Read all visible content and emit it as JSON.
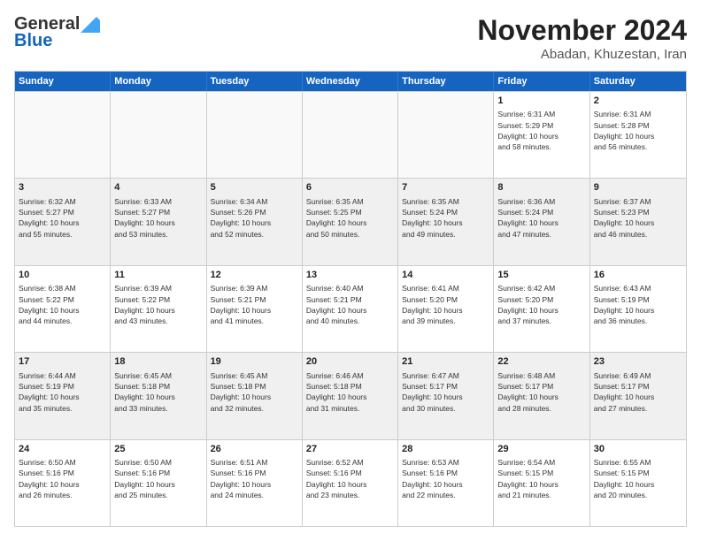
{
  "header": {
    "logo_general": "General",
    "logo_blue": "Blue",
    "month": "November 2024",
    "location": "Abadan, Khuzestan, Iran"
  },
  "days_of_week": [
    "Sunday",
    "Monday",
    "Tuesday",
    "Wednesday",
    "Thursday",
    "Friday",
    "Saturday"
  ],
  "rows": [
    [
      {
        "day": "",
        "info": "",
        "empty": true
      },
      {
        "day": "",
        "info": "",
        "empty": true
      },
      {
        "day": "",
        "info": "",
        "empty": true
      },
      {
        "day": "",
        "info": "",
        "empty": true
      },
      {
        "day": "",
        "info": "",
        "empty": true
      },
      {
        "day": "1",
        "info": "Sunrise: 6:31 AM\nSunset: 5:29 PM\nDaylight: 10 hours\nand 58 minutes."
      },
      {
        "day": "2",
        "info": "Sunrise: 6:31 AM\nSunset: 5:28 PM\nDaylight: 10 hours\nand 56 minutes."
      }
    ],
    [
      {
        "day": "3",
        "info": "Sunrise: 6:32 AM\nSunset: 5:27 PM\nDaylight: 10 hours\nand 55 minutes."
      },
      {
        "day": "4",
        "info": "Sunrise: 6:33 AM\nSunset: 5:27 PM\nDaylight: 10 hours\nand 53 minutes."
      },
      {
        "day": "5",
        "info": "Sunrise: 6:34 AM\nSunset: 5:26 PM\nDaylight: 10 hours\nand 52 minutes."
      },
      {
        "day": "6",
        "info": "Sunrise: 6:35 AM\nSunset: 5:25 PM\nDaylight: 10 hours\nand 50 minutes."
      },
      {
        "day": "7",
        "info": "Sunrise: 6:35 AM\nSunset: 5:24 PM\nDaylight: 10 hours\nand 49 minutes."
      },
      {
        "day": "8",
        "info": "Sunrise: 6:36 AM\nSunset: 5:24 PM\nDaylight: 10 hours\nand 47 minutes."
      },
      {
        "day": "9",
        "info": "Sunrise: 6:37 AM\nSunset: 5:23 PM\nDaylight: 10 hours\nand 46 minutes."
      }
    ],
    [
      {
        "day": "10",
        "info": "Sunrise: 6:38 AM\nSunset: 5:22 PM\nDaylight: 10 hours\nand 44 minutes."
      },
      {
        "day": "11",
        "info": "Sunrise: 6:39 AM\nSunset: 5:22 PM\nDaylight: 10 hours\nand 43 minutes."
      },
      {
        "day": "12",
        "info": "Sunrise: 6:39 AM\nSunset: 5:21 PM\nDaylight: 10 hours\nand 41 minutes."
      },
      {
        "day": "13",
        "info": "Sunrise: 6:40 AM\nSunset: 5:21 PM\nDaylight: 10 hours\nand 40 minutes."
      },
      {
        "day": "14",
        "info": "Sunrise: 6:41 AM\nSunset: 5:20 PM\nDaylight: 10 hours\nand 39 minutes."
      },
      {
        "day": "15",
        "info": "Sunrise: 6:42 AM\nSunset: 5:20 PM\nDaylight: 10 hours\nand 37 minutes."
      },
      {
        "day": "16",
        "info": "Sunrise: 6:43 AM\nSunset: 5:19 PM\nDaylight: 10 hours\nand 36 minutes."
      }
    ],
    [
      {
        "day": "17",
        "info": "Sunrise: 6:44 AM\nSunset: 5:19 PM\nDaylight: 10 hours\nand 35 minutes."
      },
      {
        "day": "18",
        "info": "Sunrise: 6:45 AM\nSunset: 5:18 PM\nDaylight: 10 hours\nand 33 minutes."
      },
      {
        "day": "19",
        "info": "Sunrise: 6:45 AM\nSunset: 5:18 PM\nDaylight: 10 hours\nand 32 minutes."
      },
      {
        "day": "20",
        "info": "Sunrise: 6:46 AM\nSunset: 5:18 PM\nDaylight: 10 hours\nand 31 minutes."
      },
      {
        "day": "21",
        "info": "Sunrise: 6:47 AM\nSunset: 5:17 PM\nDaylight: 10 hours\nand 30 minutes."
      },
      {
        "day": "22",
        "info": "Sunrise: 6:48 AM\nSunset: 5:17 PM\nDaylight: 10 hours\nand 28 minutes."
      },
      {
        "day": "23",
        "info": "Sunrise: 6:49 AM\nSunset: 5:17 PM\nDaylight: 10 hours\nand 27 minutes."
      }
    ],
    [
      {
        "day": "24",
        "info": "Sunrise: 6:50 AM\nSunset: 5:16 PM\nDaylight: 10 hours\nand 26 minutes."
      },
      {
        "day": "25",
        "info": "Sunrise: 6:50 AM\nSunset: 5:16 PM\nDaylight: 10 hours\nand 25 minutes."
      },
      {
        "day": "26",
        "info": "Sunrise: 6:51 AM\nSunset: 5:16 PM\nDaylight: 10 hours\nand 24 minutes."
      },
      {
        "day": "27",
        "info": "Sunrise: 6:52 AM\nSunset: 5:16 PM\nDaylight: 10 hours\nand 23 minutes."
      },
      {
        "day": "28",
        "info": "Sunrise: 6:53 AM\nSunset: 5:16 PM\nDaylight: 10 hours\nand 22 minutes."
      },
      {
        "day": "29",
        "info": "Sunrise: 6:54 AM\nSunset: 5:15 PM\nDaylight: 10 hours\nand 21 minutes."
      },
      {
        "day": "30",
        "info": "Sunrise: 6:55 AM\nSunset: 5:15 PM\nDaylight: 10 hours\nand 20 minutes."
      }
    ]
  ]
}
